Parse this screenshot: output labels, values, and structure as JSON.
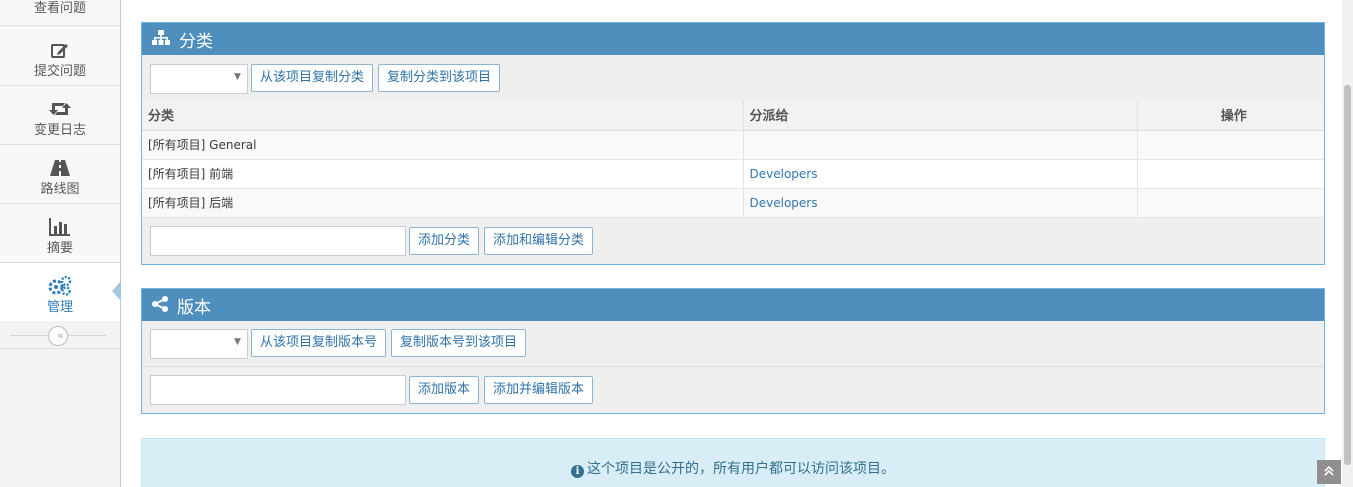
{
  "sidebar": {
    "items": [
      {
        "label": "查看问题",
        "icon": "list-icon"
      },
      {
        "label": "提交问题",
        "icon": "edit-icon"
      },
      {
        "label": "变更日志",
        "icon": "retweet-icon"
      },
      {
        "label": "路线图",
        "icon": "road-icon"
      },
      {
        "label": "摘要",
        "icon": "bar-chart-icon"
      },
      {
        "label": "管理",
        "icon": "gears-icon",
        "active": true
      }
    ],
    "collapse_glyph": "«"
  },
  "categories": {
    "title": "分类",
    "copy_from_label": "从该项目复制分类",
    "copy_to_label": "复制分类到该项目",
    "columns": [
      "分类",
      "分派给",
      "操作"
    ],
    "rows": [
      {
        "category": "[所有项目] General",
        "assigned": "",
        "actions": ""
      },
      {
        "category": "[所有项目] 前端",
        "assigned": "Developers",
        "actions": ""
      },
      {
        "category": "[所有项目] 后端",
        "assigned": "Developers",
        "actions": ""
      }
    ],
    "add_label": "添加分类",
    "add_edit_label": "添加和编辑分类"
  },
  "versions": {
    "title": "版本",
    "copy_from_label": "从该项目复制版本号",
    "copy_to_label": "复制版本号到该项目",
    "add_label": "添加版本",
    "add_edit_label": "添加并编辑版本"
  },
  "notice": {
    "text": "这个项目是公开的，所有用户都可以访问该项目。"
  },
  "colors": {
    "header_blue": "#4f8fbe",
    "active_blue": "#2b7dbc",
    "notice_bg": "#d9edf7"
  }
}
